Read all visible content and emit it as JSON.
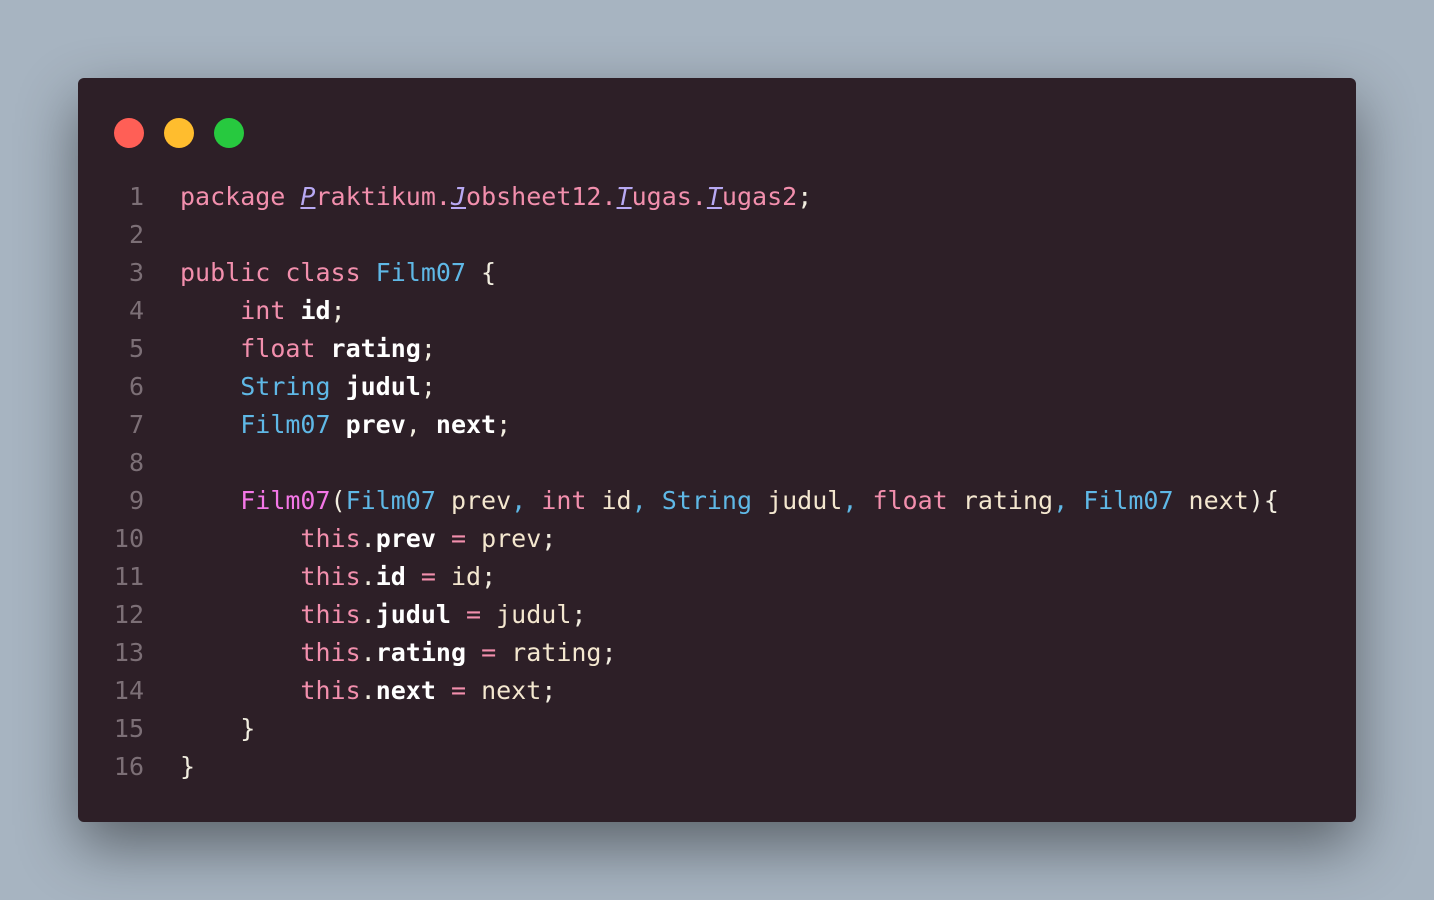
{
  "window": {
    "controls": [
      {
        "name": "close",
        "color": "#ff5f56"
      },
      {
        "name": "minimize",
        "color": "#ffbd2e"
      },
      {
        "name": "maximize",
        "color": "#27c93f"
      }
    ]
  },
  "editor": {
    "lines": [
      {
        "n": "1",
        "tokens": [
          {
            "t": "package ",
            "c": "kw"
          },
          {
            "t": "P",
            "c": "uline"
          },
          {
            "t": "raktikum.",
            "c": "pkg"
          },
          {
            "t": "J",
            "c": "uline"
          },
          {
            "t": "obsheet12.",
            "c": "pkg"
          },
          {
            "t": "T",
            "c": "uline"
          },
          {
            "t": "ugas.",
            "c": "pkg"
          },
          {
            "t": "T",
            "c": "uline"
          },
          {
            "t": "ugas2",
            "c": "pkg"
          },
          {
            "t": ";",
            "c": "punc"
          }
        ]
      },
      {
        "n": "2",
        "tokens": []
      },
      {
        "n": "3",
        "tokens": [
          {
            "t": "public ",
            "c": "kw"
          },
          {
            "t": "class ",
            "c": "kw"
          },
          {
            "t": "Film07",
            "c": "ty"
          },
          {
            "t": " {",
            "c": "punc"
          }
        ]
      },
      {
        "n": "4",
        "tokens": [
          {
            "t": "    ",
            "c": "punc"
          },
          {
            "t": "int ",
            "c": "kw"
          },
          {
            "t": "id",
            "c": "bold"
          },
          {
            "t": ";",
            "c": "punc"
          }
        ]
      },
      {
        "n": "5",
        "tokens": [
          {
            "t": "    ",
            "c": "punc"
          },
          {
            "t": "float ",
            "c": "kw"
          },
          {
            "t": "rating",
            "c": "bold"
          },
          {
            "t": ";",
            "c": "punc"
          }
        ]
      },
      {
        "n": "6",
        "tokens": [
          {
            "t": "    ",
            "c": "punc"
          },
          {
            "t": "String ",
            "c": "ty"
          },
          {
            "t": "judul",
            "c": "bold"
          },
          {
            "t": ";",
            "c": "punc"
          }
        ]
      },
      {
        "n": "7",
        "tokens": [
          {
            "t": "    ",
            "c": "punc"
          },
          {
            "t": "Film07 ",
            "c": "ty"
          },
          {
            "t": "prev",
            "c": "bold"
          },
          {
            "t": ", ",
            "c": "punc"
          },
          {
            "t": "next",
            "c": "bold"
          },
          {
            "t": ";",
            "c": "punc"
          }
        ]
      },
      {
        "n": "8",
        "tokens": []
      },
      {
        "n": "9",
        "tokens": [
          {
            "t": "    ",
            "c": "punc"
          },
          {
            "t": "Film07",
            "c": "fn"
          },
          {
            "t": "(",
            "c": "punc"
          },
          {
            "t": "Film07 ",
            "c": "ty"
          },
          {
            "t": "prev",
            "c": "param"
          },
          {
            "t": ", ",
            "c": "ty"
          },
          {
            "t": "int ",
            "c": "kw"
          },
          {
            "t": "id",
            "c": "param"
          },
          {
            "t": ", ",
            "c": "ty"
          },
          {
            "t": "String ",
            "c": "ty"
          },
          {
            "t": "judul",
            "c": "param"
          },
          {
            "t": ", ",
            "c": "ty"
          },
          {
            "t": "float ",
            "c": "kw"
          },
          {
            "t": "rating",
            "c": "param"
          },
          {
            "t": ", ",
            "c": "ty"
          },
          {
            "t": "Film07 ",
            "c": "ty"
          },
          {
            "t": "next",
            "c": "param"
          },
          {
            "t": "){",
            "c": "punc"
          }
        ]
      },
      {
        "n": "10",
        "tokens": [
          {
            "t": "        ",
            "c": "punc"
          },
          {
            "t": "this",
            "c": "kw"
          },
          {
            "t": ".",
            "c": "punc"
          },
          {
            "t": "prev",
            "c": "bold"
          },
          {
            "t": " = ",
            "c": "op"
          },
          {
            "t": "prev",
            "c": "param"
          },
          {
            "t": ";",
            "c": "punc"
          }
        ]
      },
      {
        "n": "11",
        "tokens": [
          {
            "t": "        ",
            "c": "punc"
          },
          {
            "t": "this",
            "c": "kw"
          },
          {
            "t": ".",
            "c": "punc"
          },
          {
            "t": "id",
            "c": "bold"
          },
          {
            "t": " = ",
            "c": "op"
          },
          {
            "t": "id",
            "c": "param"
          },
          {
            "t": ";",
            "c": "punc"
          }
        ]
      },
      {
        "n": "12",
        "tokens": [
          {
            "t": "        ",
            "c": "punc"
          },
          {
            "t": "this",
            "c": "kw"
          },
          {
            "t": ".",
            "c": "punc"
          },
          {
            "t": "judul",
            "c": "bold"
          },
          {
            "t": " = ",
            "c": "op"
          },
          {
            "t": "judul",
            "c": "param"
          },
          {
            "t": ";",
            "c": "punc"
          }
        ]
      },
      {
        "n": "13",
        "tokens": [
          {
            "t": "        ",
            "c": "punc"
          },
          {
            "t": "this",
            "c": "kw"
          },
          {
            "t": ".",
            "c": "punc"
          },
          {
            "t": "rating",
            "c": "bold"
          },
          {
            "t": " = ",
            "c": "op"
          },
          {
            "t": "rating",
            "c": "param"
          },
          {
            "t": ";",
            "c": "punc"
          }
        ]
      },
      {
        "n": "14",
        "tokens": [
          {
            "t": "        ",
            "c": "punc"
          },
          {
            "t": "this",
            "c": "kw"
          },
          {
            "t": ".",
            "c": "punc"
          },
          {
            "t": "next",
            "c": "bold"
          },
          {
            "t": " = ",
            "c": "op"
          },
          {
            "t": "next",
            "c": "param"
          },
          {
            "t": ";",
            "c": "punc"
          }
        ]
      },
      {
        "n": "15",
        "tokens": [
          {
            "t": "    }",
            "c": "punc"
          }
        ]
      },
      {
        "n": "16",
        "tokens": [
          {
            "t": "}",
            "c": "punc"
          }
        ]
      }
    ]
  }
}
